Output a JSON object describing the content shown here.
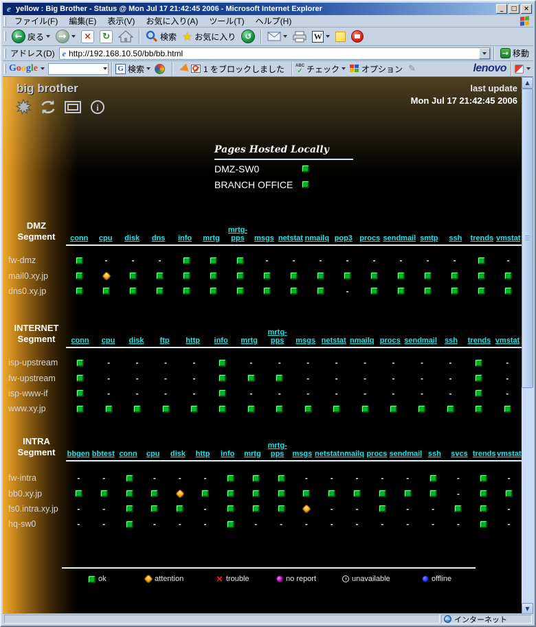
{
  "window": {
    "title": "yellow : Big Brother - Status @ Mon Jul 17 21:42:45 2006 - Microsoft Internet Explorer",
    "controls": {
      "minimize": "_",
      "maximize": "□",
      "close": "×"
    }
  },
  "menubar": {
    "items": [
      "ファイル(F)",
      "編集(E)",
      "表示(V)",
      "お気に入り(A)",
      "ツール(T)",
      "ヘルプ(H)"
    ]
  },
  "toolbar": {
    "back": "戻る",
    "search": "検索",
    "favorites": "お気に入り"
  },
  "addressbar": {
    "label": "アドレス(D)",
    "url": "http://192.168.10.50/bb/bb.html",
    "go": "移動"
  },
  "googlebar": {
    "logo": "Google",
    "input_value": "",
    "search": "検索",
    "blocked": "1 をブロックしました",
    "check": "チェック",
    "options": "オプション",
    "brand": "lenovo"
  },
  "statusbar": {
    "zone": "インターネット"
  },
  "bb": {
    "logo": "big brother",
    "last_update_label": "last update",
    "last_update_time": "Mon Jul 17 21:42:45 2006",
    "hosted": {
      "title": "Pages Hosted Locally",
      "entries": [
        {
          "name": "DMZ-SW0",
          "status": "g"
        },
        {
          "name": "BRANCH OFFICE",
          "status": "g"
        }
      ]
    },
    "segments": [
      {
        "name_lines": [
          "DMZ",
          "Segment"
        ],
        "columns": [
          "conn",
          "cpu",
          "disk",
          "dns",
          "info",
          "mrtg",
          "mrtg-\npps",
          "msgs",
          "netstat",
          "nmailq",
          "pop3",
          "procs",
          "sendmail",
          "smtp",
          "ssh",
          "trends",
          "vmstat"
        ],
        "rows": [
          {
            "host": "fw-dmz",
            "cells": [
              "g",
              "-",
              "-",
              "-",
              "g",
              "g",
              "g",
              "-",
              "-",
              "-",
              "-",
              "-",
              "-",
              "-",
              "-",
              "g",
              "-"
            ]
          },
          {
            "host": "mail0.xy.jp",
            "cells": [
              "g",
              "y",
              "g",
              "g",
              "g",
              "g",
              "g",
              "g",
              "g",
              "g",
              "g",
              "g",
              "g",
              "g",
              "g",
              "g",
              "g"
            ]
          },
          {
            "host": "dns0.xy.jp",
            "cells": [
              "g",
              "g",
              "g",
              "g",
              "g",
              "g",
              "g",
              "g",
              "g",
              "g",
              "-",
              "g",
              "g",
              "g",
              "g",
              "g",
              "g"
            ]
          }
        ]
      },
      {
        "name_lines": [
          "INTERNET",
          "Segment"
        ],
        "columns": [
          "conn",
          "cpu",
          "disk",
          "ftp",
          "http",
          "info",
          "mrtg",
          "mrtg-\npps",
          "msgs",
          "netstat",
          "nmailq",
          "procs",
          "sendmail",
          "ssh",
          "trends",
          "vmstat"
        ],
        "rows": [
          {
            "host": "isp-upstream",
            "cells": [
              "g",
              "-",
              "-",
              "-",
              "-",
              "g",
              "-",
              "-",
              "-",
              "-",
              "-",
              "-",
              "-",
              "-",
              "g",
              "-"
            ]
          },
          {
            "host": "fw-upstream",
            "cells": [
              "g",
              "-",
              "-",
              "-",
              "-",
              "g",
              "g",
              "g",
              "-",
              "-",
              "-",
              "-",
              "-",
              "-",
              "g",
              "-"
            ]
          },
          {
            "host": "isp-www-if",
            "cells": [
              "g",
              "-",
              "-",
              "-",
              "-",
              "g",
              "-",
              "-",
              "-",
              "-",
              "-",
              "-",
              "-",
              "-",
              "g",
              "-"
            ]
          },
          {
            "host": "www.xy.jp",
            "cells": [
              "g",
              "g",
              "g",
              "g",
              "g",
              "g",
              "g",
              "g",
              "g",
              "g",
              "g",
              "g",
              "g",
              "g",
              "g",
              "g"
            ]
          }
        ]
      },
      {
        "name_lines": [
          "INTRA",
          "Segment"
        ],
        "columns": [
          "bbgen",
          "bbtest",
          "conn",
          "cpu",
          "disk",
          "http",
          "info",
          "mrtg",
          "mrtg-\npps",
          "msgs",
          "netstat",
          "nmailq",
          "procs",
          "sendmail",
          "ssh",
          "svcs",
          "trends",
          "vmstat"
        ],
        "rows": [
          {
            "host": "fw-intra",
            "cells": [
              "-",
              "-",
              "g",
              "-",
              "-",
              "-",
              "g",
              "g",
              "g",
              "-",
              "-",
              "-",
              "-",
              "-",
              "g",
              "-",
              "g",
              "-"
            ]
          },
          {
            "host": "bb0.xy.jp",
            "cells": [
              "g",
              "g",
              "g",
              "g",
              "y",
              "g",
              "g",
              "g",
              "g",
              "g",
              "g",
              "g",
              "g",
              "g",
              "g",
              "-",
              "g",
              "g"
            ]
          },
          {
            "host": "fs0.intra.xy.jp",
            "cells": [
              "-",
              "-",
              "g",
              "g",
              "g",
              "-",
              "g",
              "g",
              "g",
              "y",
              "-",
              "-",
              "g",
              "-",
              "-",
              "g",
              "g",
              "-"
            ]
          },
          {
            "host": "hq-sw0",
            "cells": [
              "-",
              "-",
              "g",
              "-",
              "-",
              "-",
              "g",
              "-",
              "-",
              "-",
              "-",
              "-",
              "-",
              "-",
              "-",
              "-",
              "g",
              "-"
            ]
          }
        ]
      }
    ],
    "legend": [
      {
        "label": "ok",
        "type": "g"
      },
      {
        "label": "attention",
        "type": "y"
      },
      {
        "label": "trouble",
        "type": "r"
      },
      {
        "label": "no report",
        "type": "p"
      },
      {
        "label": "unavailable",
        "type": "u"
      },
      {
        "label": "offline",
        "type": "b"
      }
    ]
  },
  "colors": {
    "link": "#1fe3e3",
    "ok": "#00b227",
    "attention": "#ffa512",
    "trouble": "#ff2020",
    "no_report": "#b400b4",
    "offline": "#1628f0",
    "page_gradient": "#f0a82e",
    "titlebar": "#0a246a"
  }
}
